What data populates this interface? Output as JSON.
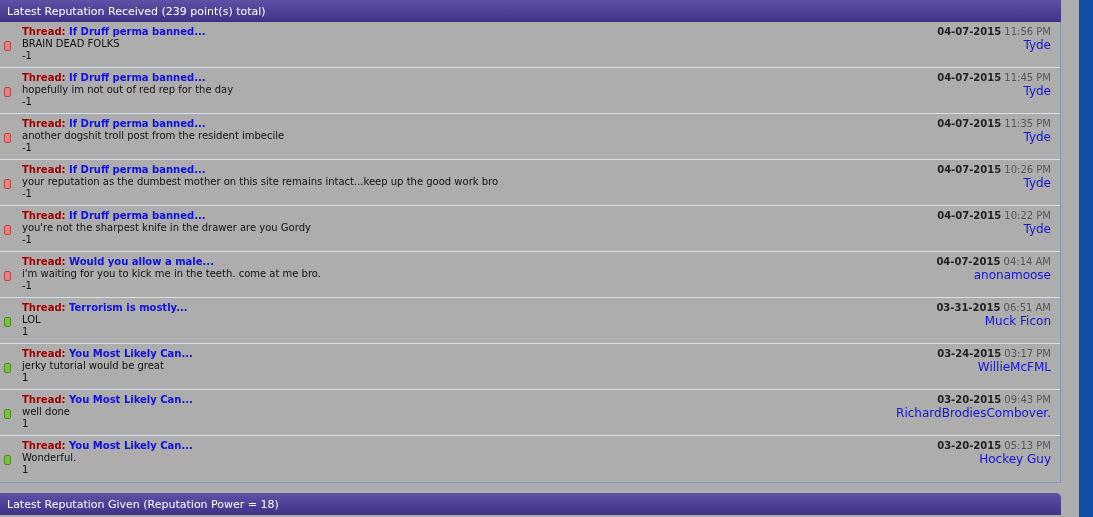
{
  "received": {
    "title": "Latest Reputation Received (239 point(s) total)",
    "rows": [
      {
        "kind": "negative",
        "thread_label": "Thread:",
        "thread": "If Druff perma banned...",
        "comment": "BRAIN DEAD FOLKS",
        "points": "-1",
        "date": "04-07-2015",
        "time": "11:56 PM",
        "user": "Tyde"
      },
      {
        "kind": "negative",
        "thread_label": "Thread:",
        "thread": "If Druff perma banned...",
        "comment": "hopefully im not out of red rep for the day",
        "points": "-1",
        "date": "04-07-2015",
        "time": "11:45 PM",
        "user": "Tyde"
      },
      {
        "kind": "negative",
        "thread_label": "Thread:",
        "thread": "If Druff perma banned...",
        "comment": "another dogshit troll post from the resident imbecile",
        "points": "-1",
        "date": "04-07-2015",
        "time": "11:35 PM",
        "user": "Tyde"
      },
      {
        "kind": "negative",
        "thread_label": "Thread:",
        "thread": "If Druff perma banned...",
        "comment": "your reputation as the dumbest mother on this site remains intact...keep up the good work bro",
        "points": "-1",
        "date": "04-07-2015",
        "time": "10:26 PM",
        "user": "Tyde"
      },
      {
        "kind": "negative",
        "thread_label": "Thread:",
        "thread": "If Druff perma banned...",
        "comment": "you're not the sharpest knife in the drawer are you Gordy",
        "points": "-1",
        "date": "04-07-2015",
        "time": "10:22 PM",
        "user": "Tyde"
      },
      {
        "kind": "negative",
        "thread_label": "Thread:",
        "thread": "Would you allow a male...",
        "comment": "i'm waiting for you to kick me in the teeth. come at me bro.",
        "points": "-1",
        "date": "04-07-2015",
        "time": "04:14 AM",
        "user": "anonamoose"
      },
      {
        "kind": "positive",
        "thread_label": "Thread:",
        "thread": "Terrorism is mostly...",
        "comment": "LOL",
        "points": "1",
        "date": "03-31-2015",
        "time": "06:51 AM",
        "user": "Muck Ficon"
      },
      {
        "kind": "positive",
        "thread_label": "Thread:",
        "thread": "You Most Likely Can...",
        "comment": "jerky tutorial would be great",
        "points": "1",
        "date": "03-24-2015",
        "time": "03:17 PM",
        "user": "WillieMcFML"
      },
      {
        "kind": "positive",
        "thread_label": "Thread:",
        "thread": "You Most Likely Can...",
        "comment": "well done",
        "points": "1",
        "date": "03-20-2015",
        "time": "09:43 PM",
        "user": "RichardBrodiesCombover."
      },
      {
        "kind": "positive",
        "thread_label": "Thread:",
        "thread": "You Most Likely Can...",
        "comment": "Wonderful.",
        "points": "1",
        "date": "03-20-2015",
        "time": "05:13 PM",
        "user": "Hockey Guy"
      }
    ]
  },
  "given": {
    "title": "Latest Reputation Given (Reputation Power = 18)"
  }
}
